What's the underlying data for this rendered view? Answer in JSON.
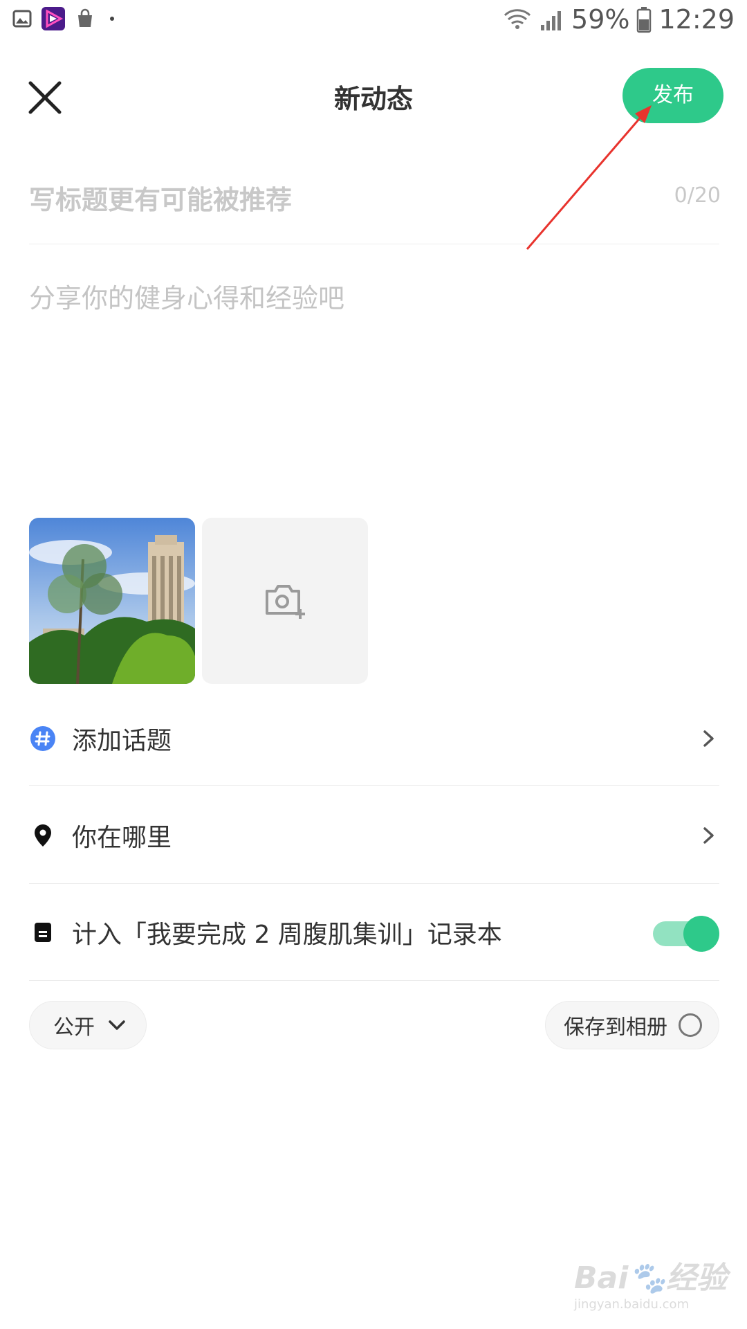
{
  "status_bar": {
    "battery": "59%",
    "time": "12:29",
    "icons": [
      "gallery-icon",
      "video-app-icon",
      "shopping-bag-icon",
      "dot-icon",
      "wifi-icon",
      "signal-icon",
      "battery-icon"
    ]
  },
  "header": {
    "title": "新动态",
    "publish_label": "发布",
    "close_icon": "close-icon"
  },
  "title_field": {
    "placeholder": "写标题更有可能被推荐",
    "count": "0/20"
  },
  "body_field": {
    "placeholder": "分享你的健身心得和经验吧"
  },
  "media": {
    "add_icon": "camera-add-icon"
  },
  "options": [
    {
      "icon": "hashtag-icon",
      "label": "添加话题"
    },
    {
      "icon": "location-pin-icon",
      "label": "你在哪里"
    },
    {
      "icon": "notebook-icon",
      "label": "计入「我要完成 2 周腹肌集训」记录本",
      "toggle_on": true
    }
  ],
  "footer": {
    "visibility_label": "公开",
    "save_album_label": "保存到相册"
  },
  "colors": {
    "accent": "#2ec98a",
    "accent_light": "#92e2c1",
    "placeholder": "#c8c8c8"
  }
}
